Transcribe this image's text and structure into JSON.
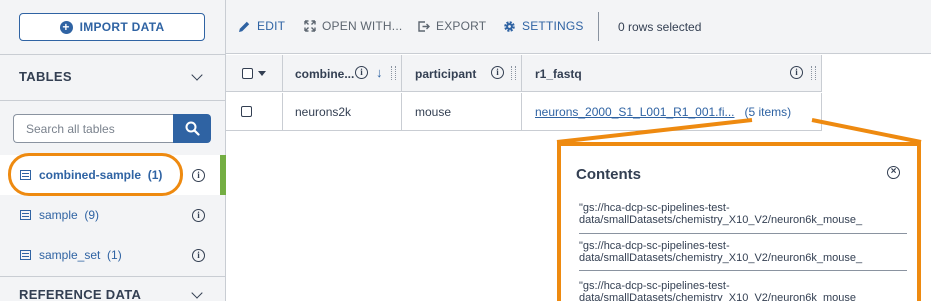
{
  "sidebar": {
    "import_label": "IMPORT DATA",
    "tables_heading": "TABLES",
    "search_placeholder": "Search all tables",
    "tables": [
      {
        "label": "combined-sample",
        "count": "(1)",
        "active": true
      },
      {
        "label": "sample",
        "count": "(9)",
        "active": false
      },
      {
        "label": "sample_set",
        "count": "(1)",
        "active": false
      }
    ],
    "reference_heading": "REFERENCE DATA"
  },
  "toolbar": {
    "edit_label": "EDIT",
    "open_with_label": "OPEN WITH...",
    "export_label": "EXPORT",
    "settings_label": "SETTINGS",
    "rows_selected": "0 rows selected"
  },
  "grid": {
    "columns": [
      "combine...",
      "participant",
      "r1_fastq"
    ],
    "rows": [
      {
        "combined_sample_id": "neurons2k",
        "participant": "mouse",
        "r1_fastq_link": "neurons_2000_S1_L001_R1_001.fi...",
        "r1_fastq_count": "(5 items)"
      }
    ]
  },
  "popover": {
    "title": "Contents",
    "items": [
      "\"gs://hca-dcp-sc-pipelines-test-\ndata/smallDatasets/chemistry_X10_V2/neuron6k_mouse_",
      "\"gs://hca-dcp-sc-pipelines-test-\ndata/smallDatasets/chemistry_X10_V2/neuron6k_mouse_",
      "\"gs://hca-dcp-sc-pipelines-test-\ndata/smallDatasets/chemistry_X10_V2/neuron6k_mouse_"
    ]
  },
  "colors": {
    "accent": "#2f63a3",
    "highlight": "#ee8a10",
    "active_bar": "#74ae43",
    "panel_bg": "#f3f4f6"
  }
}
